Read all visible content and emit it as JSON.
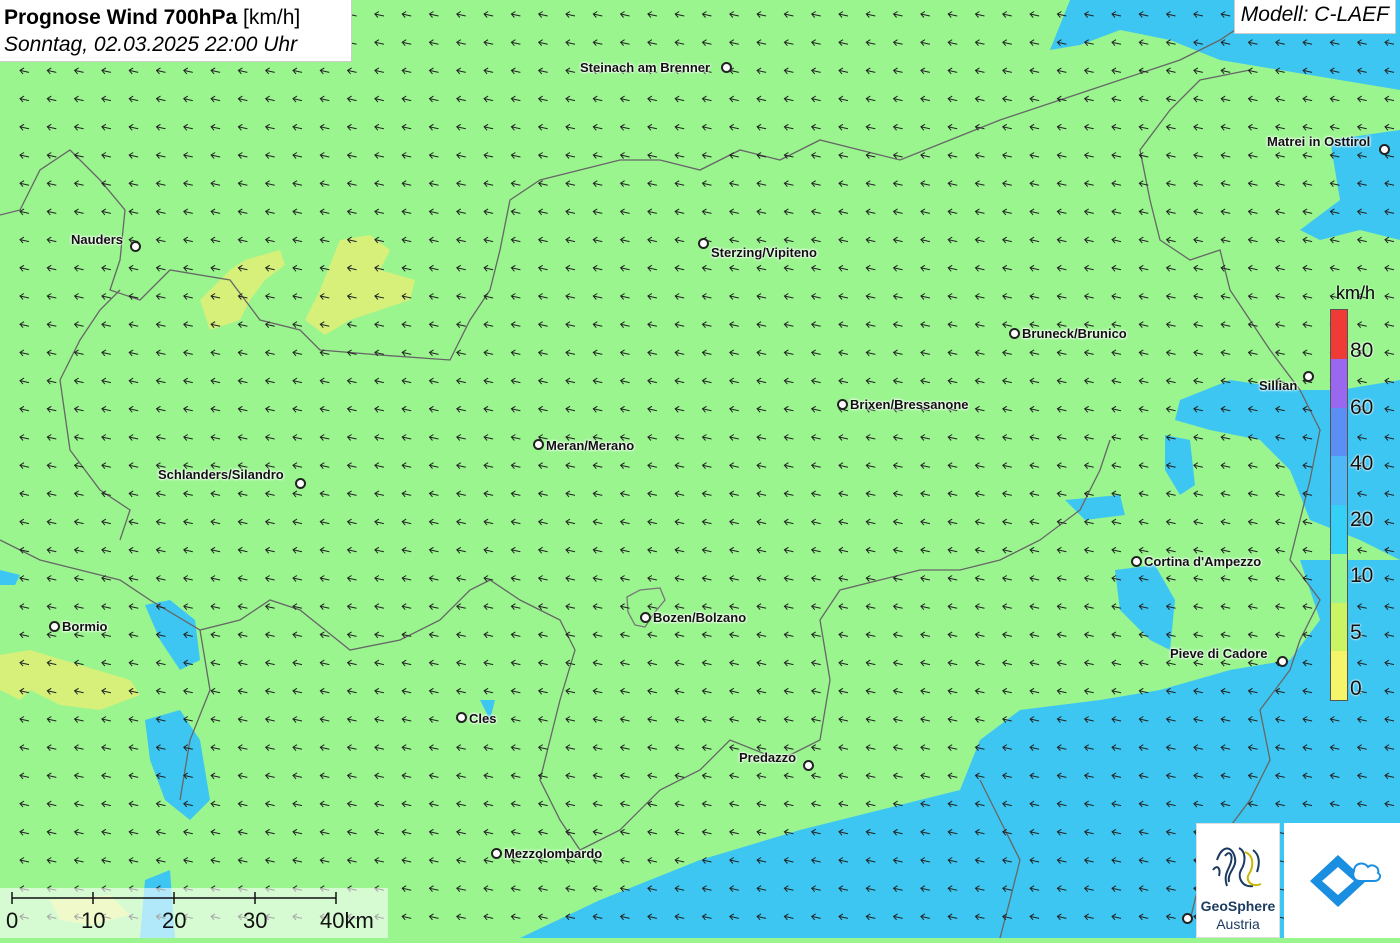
{
  "header": {
    "title_bold": "Prognose Wind 700hPa",
    "title_unit": "[km/h]",
    "subtitle": "Sonntag, 02.03.2025 22:00 Uhr",
    "model": "Modell: C-LAEF"
  },
  "wind": {
    "direction": "from east (arrows pointing west-northwest)",
    "arrow_color": "#222222"
  },
  "places": [
    {
      "name": "Steinach am Brenner"
    },
    {
      "name": "Matrei in Osttirol"
    },
    {
      "name": "Nauders"
    },
    {
      "name": "Sterzing/Vipiteno"
    },
    {
      "name": "Bruneck/Brunico"
    },
    {
      "name": "Sillian"
    },
    {
      "name": "Brixen/Bressanone"
    },
    {
      "name": "Meran/Merano"
    },
    {
      "name": "Schlanders/Silandro"
    },
    {
      "name": "Cortina d'Ampezzo"
    },
    {
      "name": "Bormio"
    },
    {
      "name": "Bozen/Bolzano"
    },
    {
      "name": "Pieve di Cadore"
    },
    {
      "name": "Cles"
    },
    {
      "name": "Predazzo"
    },
    {
      "name": "Mezzolombardo"
    }
  ],
  "legend": {
    "unit": "km/h",
    "colors": [
      "#ef3b36",
      "#9a68ef",
      "#5b8ff5",
      "#4db8f5",
      "#35d0f5",
      "#9af58f",
      "#c9f565",
      "#f5f56a"
    ],
    "labels": [
      "80",
      "60",
      "40",
      "20",
      "10",
      "5",
      "0"
    ]
  },
  "scale_bar": {
    "labels": [
      "0",
      "10",
      "20",
      "30",
      "40km"
    ]
  },
  "logos": {
    "geosphere_line1": "GeoSphere",
    "geosphere_line2": "Austria"
  },
  "colors": {
    "calm_green": "#9af58f",
    "light_blue": "#35c6f4",
    "yellow": "#d9f06e"
  }
}
